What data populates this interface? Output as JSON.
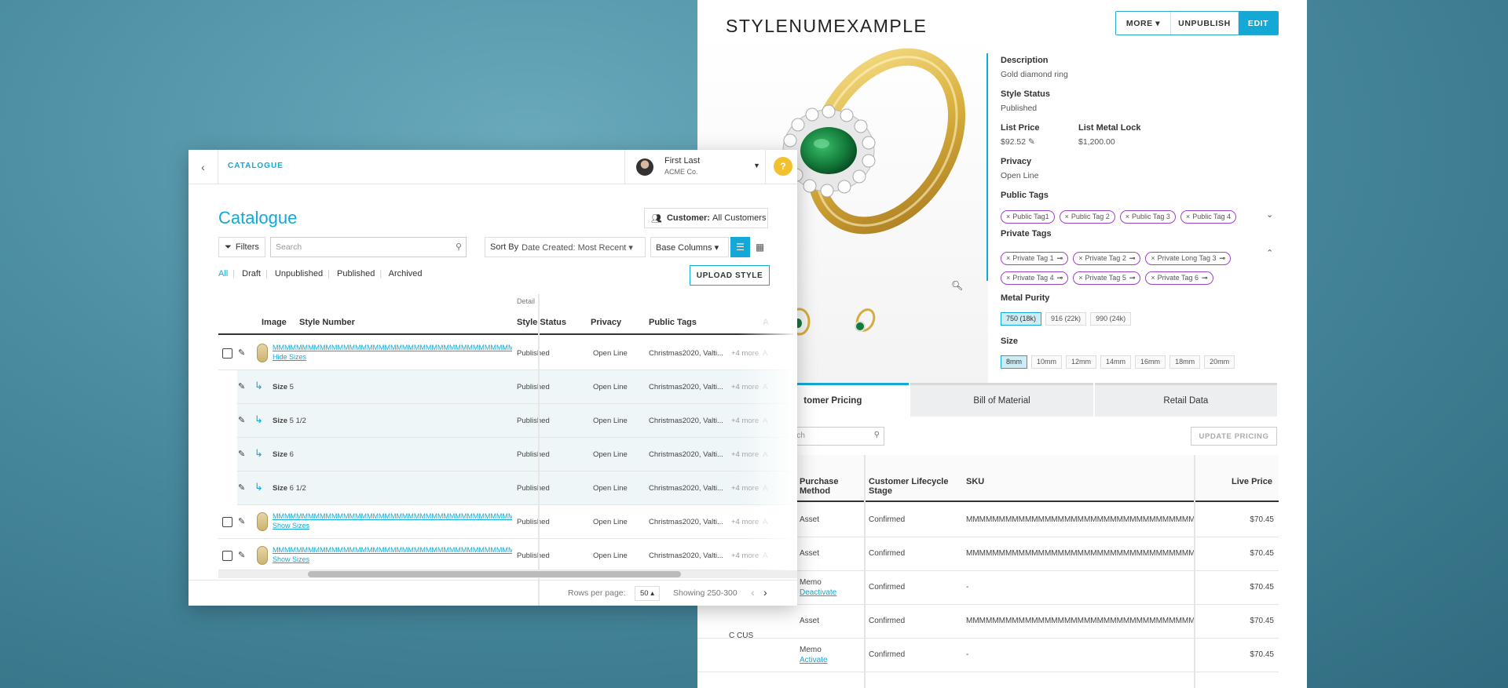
{
  "detail": {
    "title": "STYLENUMEXAMPLE",
    "buttons": {
      "more": "MORE ▾",
      "unpublish": "UNPUBLISH",
      "edit": "EDIT"
    },
    "description_label": "Description",
    "description": "Gold diamond ring",
    "style_status_label": "Style Status",
    "style_status": "Published",
    "list_price_label": "List Price",
    "list_price": "$92.52",
    "list_metal_lock_label": "List Metal Lock",
    "list_metal_lock": "$1,200.00",
    "privacy_label": "Privacy",
    "privacy": "Open Line",
    "public_tags_label": "Public Tags",
    "public_tags": [
      "Public Tag1",
      "Public Tag 2",
      "Public Tag 3",
      "Public Tag 4"
    ],
    "private_tags_label": "Private Tags",
    "private_tags": [
      "Private Tag 1",
      "Private Tag 2",
      "Private Long Tag 3",
      "Private Tag 4",
      "Private Tag 5",
      "Private Tag 6"
    ],
    "metal_purity_label": "Metal Purity",
    "metal_purity": [
      "750 (18k)",
      "916 (22k)",
      "990 (24k)"
    ],
    "size_label": "Size",
    "sizes": [
      "8mm",
      "10mm",
      "12mm",
      "14mm",
      "16mm",
      "18mm",
      "20mm"
    ],
    "tabs": [
      "tomer Pricing",
      "Bill of Material",
      "Retail Data"
    ],
    "pricing_search_placeholder": "rch",
    "update_pricing": "UPDATE PRICING",
    "pricing_headers": {
      "purchase": "Purchase Method",
      "lifecycle": "Customer Lifecycle Stage",
      "sku": "SKU",
      "live": "Live Price"
    },
    "pricing_rows": [
      {
        "method": "Asset",
        "link": "",
        "stage": "Confirmed",
        "sku": "MMMMMMMMMMMMMMMMMMMMMMMMMMMMMMMMMMMMMMMM",
        "price": "$70.45"
      },
      {
        "method": "Asset",
        "link": "",
        "stage": "Confirmed",
        "sku": "MMMMMMMMMMMMMMMMMMMMMMMMMMMMMMMMMMMMMMMM",
        "price": "$70.45"
      },
      {
        "method": "Memo",
        "link": "Deactivate",
        "stage": "Confirmed",
        "sku": "-",
        "price": "$70.45"
      },
      {
        "method": "Asset",
        "link": "",
        "stage": "Confirmed",
        "sku": "MMMMMMMMMMMMMMMMMMMMMMMMMMMMMMMMMMMMMMMM",
        "price": "$70.45"
      },
      {
        "method": "Memo",
        "link": "Activate",
        "stage": "Confirmed",
        "sku": "-",
        "price": "$70.45"
      }
    ],
    "customer_group": "C CUS"
  },
  "catalogue": {
    "breadcrumb": "CATALOGUE",
    "user_name": "First Last",
    "user_org": "ACME Co.",
    "help": "?",
    "title": "Catalogue",
    "customer_label": "Customer:",
    "customer_value": "All Customers",
    "filters": "Filters",
    "search_placeholder": "Search",
    "sort_label": "Sort By",
    "sort_value": "Date Created: Most Recent ▾",
    "columns": "Base Columns ▾",
    "segments": [
      "All",
      "Draft",
      "Unpublished",
      "Published",
      "Archived"
    ],
    "upload": "UPLOAD STYLE",
    "detail_group": "Detail",
    "headers": {
      "image": "Image",
      "style": "Style Number",
      "status": "Style Status",
      "privacy": "Privacy",
      "tags": "Public Tags",
      "extra": "A"
    },
    "rows": [
      {
        "type": "main",
        "sku": "MMMMMMMMMMMMMMMMMMMMMMMMMMMMMMMMMMMMMMMMMMMMMMMMM",
        "link": "Hide Sizes",
        "status": "Published",
        "privacy": "Open Line",
        "tags": "Christmas2020, Valti...",
        "more": "+4 more",
        "extra": "A"
      },
      {
        "type": "sub",
        "size_prefix": "Size",
        "size": "5",
        "status": "Published",
        "privacy": "Open Line",
        "tags": "Christmas2020, Valti...",
        "more": "+4 more",
        "extra": "A"
      },
      {
        "type": "sub",
        "size_prefix": "Size",
        "size": "5 1/2",
        "status": "Published",
        "privacy": "Open Line",
        "tags": "Christmas2020, Valti...",
        "more": "+4 more",
        "extra": "A"
      },
      {
        "type": "sub",
        "size_prefix": "Size",
        "size": "6",
        "status": "Published",
        "privacy": "Open Line",
        "tags": "Christmas2020, Valti...",
        "more": "+4 more",
        "extra": "A"
      },
      {
        "type": "sub",
        "size_prefix": "Size",
        "size": "6 1/2",
        "status": "Published",
        "privacy": "Open Line",
        "tags": "Christmas2020, Valti...",
        "more": "+4 more",
        "extra": "A"
      },
      {
        "type": "main",
        "sku": "MMMMMMMMMMMMMMMMMMMMMMMMMMMMMMMMMMMMMMMMMMMMMMMMM",
        "link": "Show Sizes",
        "status": "Published",
        "privacy": "Open Line",
        "tags": "Christmas2020, Valti...",
        "more": "+4 more",
        "extra": "A"
      },
      {
        "type": "main",
        "sku": "MMMMMMMMMMMMMMMMMMMMMMMMMMMMMMMMMMMMMMMMMMMMMMMMM",
        "link": "Show Sizes",
        "status": "Published",
        "privacy": "Open Line",
        "tags": "Christmas2020, Valti...",
        "more": "+4 more",
        "extra": "A"
      }
    ],
    "rows_per_page_label": "Rows per page:",
    "rows_per_page": "50 ▴",
    "showing": "Showing 250-300"
  }
}
